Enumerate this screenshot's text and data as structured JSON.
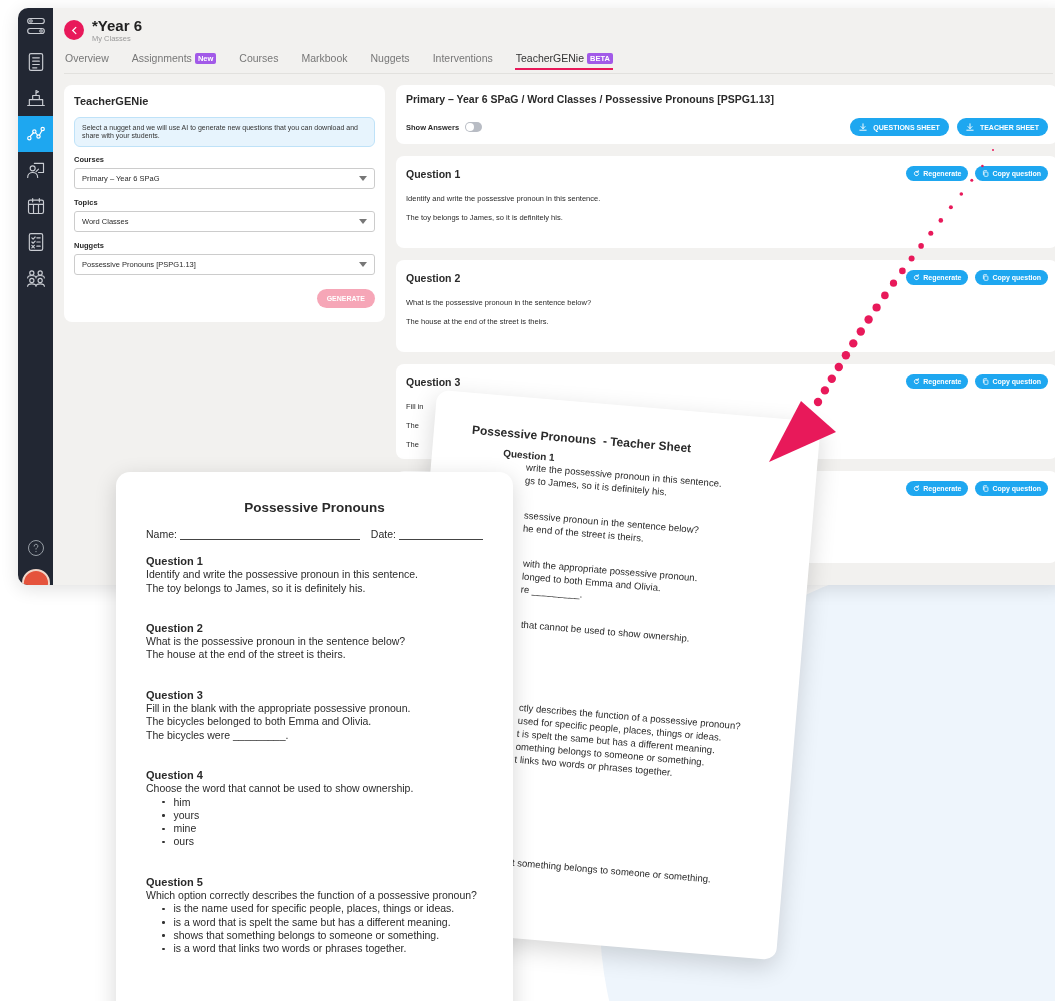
{
  "sidebar": {
    "items": [
      {
        "kind": "workflow",
        "selected": false
      },
      {
        "kind": "list",
        "selected": false
      },
      {
        "kind": "school",
        "selected": false
      },
      {
        "kind": "graph",
        "selected": true
      },
      {
        "kind": "teacher",
        "selected": false
      },
      {
        "kind": "calendar",
        "selected": false
      },
      {
        "kind": "checklist",
        "selected": false
      },
      {
        "kind": "people",
        "selected": false
      }
    ]
  },
  "header": {
    "title": "*Year 6",
    "subtitle": "My Classes"
  },
  "tabs": [
    {
      "label": "Overview",
      "selected": false
    },
    {
      "label": "Assignments",
      "badge": "New",
      "selected": false
    },
    {
      "label": "Courses",
      "selected": false
    },
    {
      "label": "Markbook",
      "selected": false
    },
    {
      "label": "Nuggets",
      "selected": false
    },
    {
      "label": "Interventions",
      "selected": false
    },
    {
      "label": "TeacherGENie",
      "badge": "BETA",
      "selected": true
    }
  ],
  "generator": {
    "title": "TeacherGENie",
    "info": "Select a nugget and we will use AI to generate new questions that you can download and share with your students.",
    "fields": [
      {
        "label": "Courses",
        "value": "Primary – Year 6 SPaG"
      },
      {
        "label": "Topics",
        "value": "Word Classes"
      },
      {
        "label": "Nuggets",
        "value": "Possessive Pronouns [PSPG1.13]"
      }
    ],
    "button": {
      "label": "GENERATE",
      "disabled": true
    }
  },
  "results": {
    "breadcrumb": "Primary – Year 6 SPaG / Word Classes / Possessive Pronouns [PSPG1.13]",
    "show_answers": {
      "label": "Show Answers",
      "on": false
    },
    "downloads": [
      "QUESTIONS SHEET",
      "TEACHER SHEET"
    ],
    "questions": [
      {
        "title": "Question 1",
        "lines": [
          "Identify and write the possessive pronoun in this sentence.",
          "The toy belongs to James, so it is definitely his."
        ],
        "regenerate": "Regenerate",
        "copy": "Copy question"
      },
      {
        "title": "Question 2",
        "lines": [
          "What is the possessive pronoun in the sentence below?",
          "The house at the end of the street is theirs."
        ],
        "regenerate": "Regenerate",
        "copy": "Copy question"
      },
      {
        "title": "Question 3",
        "lines": [
          "Fill in",
          "The",
          "The"
        ],
        "regenerate": "Regenerate",
        "copy": "Copy question"
      },
      {
        "regenerate": "Regenerate",
        "copy": "Copy question"
      }
    ]
  },
  "teacher_sheet": {
    "title": "Possessive Pronouns  - Teacher Sheet",
    "blocks": [
      {
        "heading": "Question 1",
        "lines": [
          "write the possessive pronoun in this sentence.",
          "gs to James, so it is definitely his."
        ]
      },
      {
        "lines": [
          "ssessive pronoun in the sentence below?",
          "he end of the street is theirs."
        ]
      },
      {
        "lines": [
          "with the appropriate possessive pronoun.",
          "longed to both Emma and Olivia.",
          "re _________."
        ]
      },
      {
        "lines": [
          "that cannot be used to show ownership."
        ]
      },
      {
        "lines": [
          "ctly describes the function of a possessive pronoun?",
          "used for specific people, places, things or ideas.",
          "t is spelt the same but has a different meaning.",
          "omething belongs to someone or something.",
          "t links two words or phrases together."
        ]
      },
      {
        "lines": [
          "t something belongs to someone or something."
        ]
      }
    ]
  },
  "question_sheet": {
    "title": "Possessive Pronouns",
    "name_label": "Name:",
    "date_label": "Date:",
    "questions": [
      {
        "title": "Question 1",
        "lines": [
          "Identify and write the possessive pronoun in this sentence.",
          "The toy belongs to James, so it is definitely his."
        ]
      },
      {
        "title": "Question 2",
        "lines": [
          "What is the possessive pronoun in the sentence below?",
          "The house at the end of the street is theirs."
        ]
      },
      {
        "title": "Question 3",
        "lines": [
          "Fill in the blank with the appropriate possessive pronoun.",
          "The bicycles belonged to both Emma and Olivia.",
          "The bicycles were _________."
        ]
      },
      {
        "title": "Question 4",
        "lines": [
          "Choose the word that cannot be used to show ownership."
        ],
        "options": [
          "him",
          "yours",
          "mine",
          "ours"
        ]
      },
      {
        "title": "Question 5",
        "lines": [
          "Which option correctly describes the function of a possessive pronoun?"
        ],
        "options": [
          "is the name used for specific people, places, things or ideas.",
          "is a word that is spelt the same but has a different meaning.",
          "shows that something belongs to someone or something.",
          "is a word that links two words or phrases together."
        ]
      }
    ]
  }
}
